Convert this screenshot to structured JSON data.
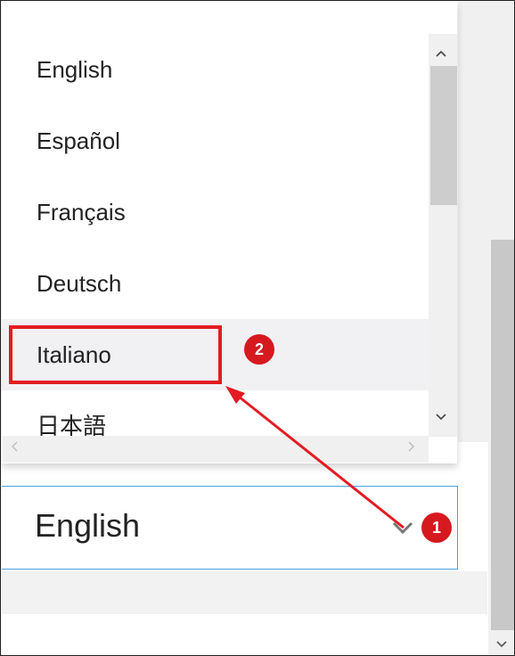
{
  "dropdown": {
    "options": [
      "English",
      "Español",
      "Français",
      "Deutsch",
      "Italiano",
      "日本語"
    ],
    "hovered_option": "Italiano"
  },
  "select": {
    "value": "English"
  },
  "annotations": {
    "step_1": "1",
    "step_2": "2",
    "color": "#e31b23"
  },
  "scroll_icons": {
    "up": "chevron-up-icon",
    "down": "chevron-down-icon",
    "left": "chevron-left-icon",
    "right": "chevron-right-icon"
  }
}
